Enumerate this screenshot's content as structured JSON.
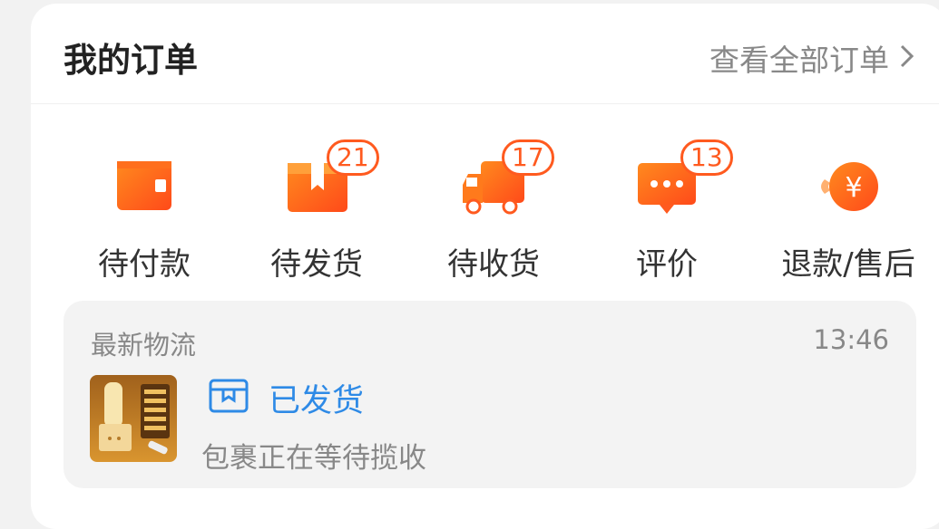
{
  "header": {
    "title": "我的订单",
    "view_all": "查看全部订单"
  },
  "orders": [
    {
      "label": "待付款",
      "icon": "wallet-icon"
    },
    {
      "label": "待发货",
      "icon": "package-icon",
      "badge": "21"
    },
    {
      "label": "待收货",
      "icon": "truck-icon",
      "badge": "17"
    },
    {
      "label": "评价",
      "icon": "comment-icon",
      "badge": "13"
    },
    {
      "label": "退款/售后",
      "icon": "refund-icon"
    }
  ],
  "logistics": {
    "title": "最新物流",
    "time": "13:46",
    "status": "已发货",
    "description": "包裹正在等待揽收"
  },
  "colors": {
    "accent_orange": "#ff5a1f",
    "shipped_blue": "#2e8ae6"
  }
}
